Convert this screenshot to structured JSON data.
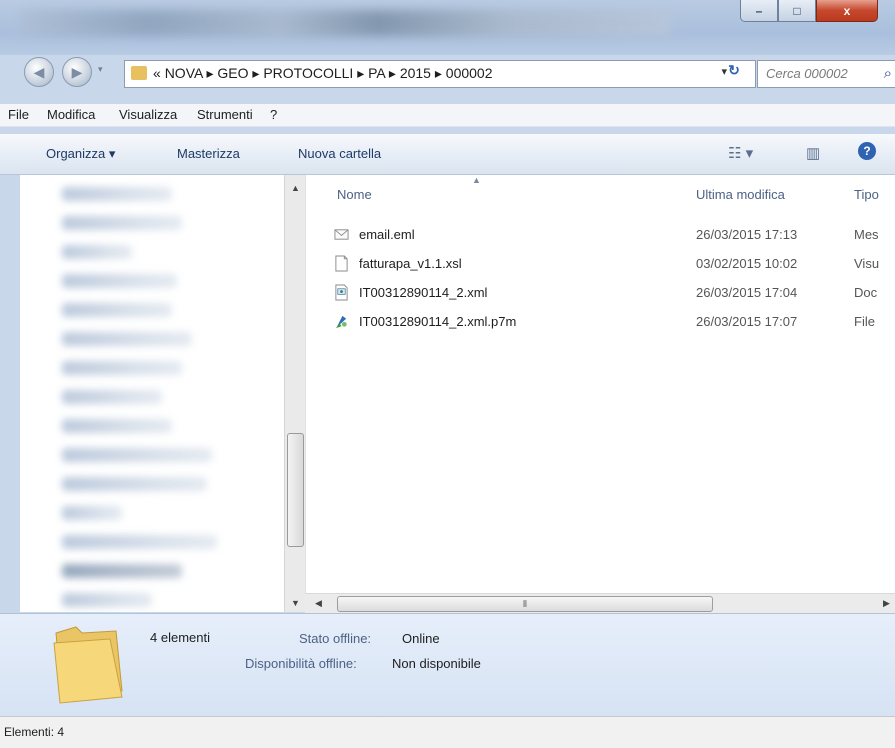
{
  "window": {
    "minimize_glyph": "–",
    "maximize_glyph": "□",
    "close_glyph": "x"
  },
  "navigation": {
    "back_glyph": "◀",
    "forward_glyph": "▶",
    "breadcrumb_prefix": "«",
    "breadcrumbs": [
      "NOVA",
      "GEO",
      "PROTOCOLLI",
      "PA",
      "2015",
      "000002"
    ],
    "separator": "▸",
    "dropdown_glyph": "▾",
    "refresh_glyph": "↻",
    "search_placeholder": "Cerca 000002"
  },
  "menu": {
    "file": "File",
    "modifica": "Modifica",
    "visualizza": "Visualizza",
    "strumenti": "Strumenti",
    "help": "?"
  },
  "commandbar": {
    "organizza": "Organizza ▾",
    "masterizza": "Masterizza",
    "nuova_cartella": "Nuova cartella"
  },
  "columns": {
    "name": "Nome",
    "modified": "Ultima modifica",
    "type": "Tipo"
  },
  "files": [
    {
      "name": "email.eml",
      "modified": "26/03/2015 17:13",
      "type": "Mes",
      "icon": "email-icon"
    },
    {
      "name": "fatturapa_v1.1.xsl",
      "modified": "03/02/2015 10:02",
      "type": "Visu",
      "icon": "document-icon"
    },
    {
      "name": "IT00312890114_2.xml",
      "modified": "26/03/2015 17:04",
      "type": "Doc",
      "icon": "xml-icon"
    },
    {
      "name": "IT00312890114_2.xml.p7m",
      "modified": "26/03/2015 17:07",
      "type": "File",
      "icon": "signed-file-icon"
    }
  ],
  "details": {
    "count": "4 elementi",
    "offline_status_label": "Stato offline:",
    "offline_status_value": "Online",
    "offline_avail_label": "Disponibilità offline:",
    "offline_avail_value": "Non disponibile"
  },
  "statusbar": {
    "text": "Elementi: 4"
  },
  "colors": {
    "accent": "#1e3a66",
    "folder": "#e7c160"
  }
}
